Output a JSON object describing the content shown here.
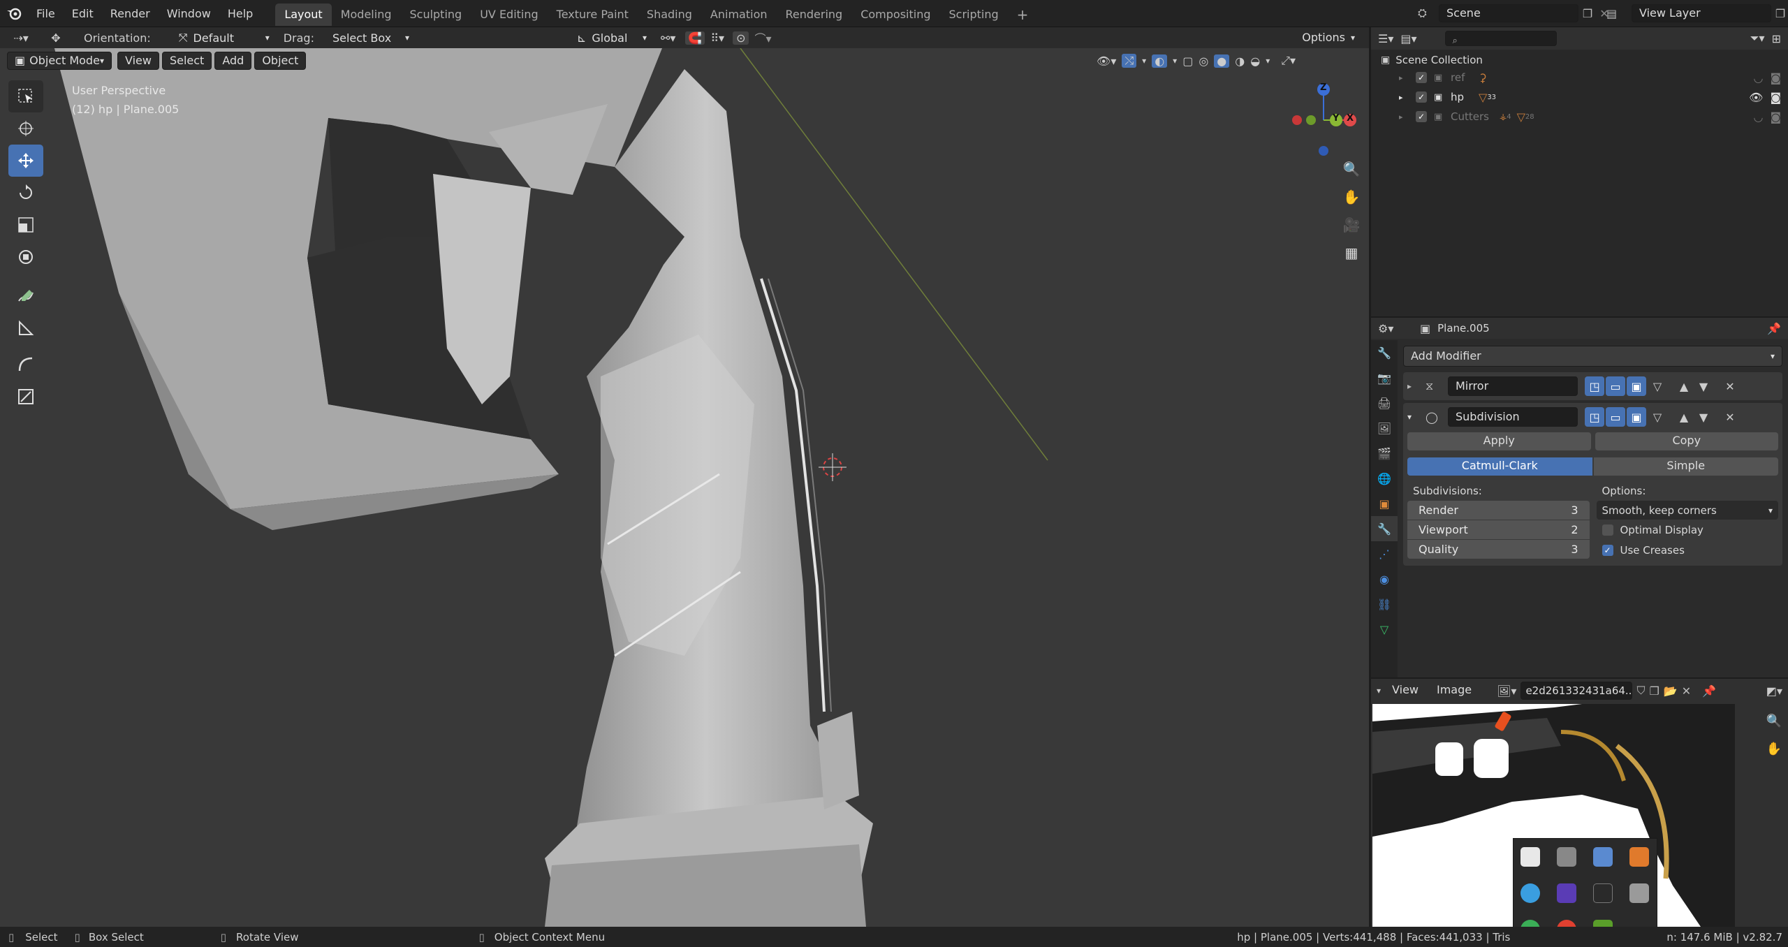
{
  "topbar": {
    "menus": [
      "File",
      "Edit",
      "Render",
      "Window",
      "Help"
    ],
    "workspaces": [
      "Layout",
      "Modeling",
      "Sculpting",
      "UV Editing",
      "Texture Paint",
      "Shading",
      "Animation",
      "Rendering",
      "Compositing",
      "Scripting"
    ],
    "active_workspace": "Layout",
    "add_tab": "+",
    "scene": "Scene",
    "view_layer": "View Layer"
  },
  "tool_header": {
    "orientation_label": "Orientation:",
    "orientation_value": "Default",
    "drag_label": "Drag:",
    "drag_value": "Select Box",
    "transform_orientation": "Global",
    "options": "Options"
  },
  "viewport_header": {
    "mode": "Object Mode",
    "menus": [
      "View",
      "Select",
      "Add",
      "Object"
    ]
  },
  "viewport": {
    "line1": "User Perspective",
    "line2": "(12) hp | Plane.005",
    "gizmo": {
      "z": "Z",
      "y": "Y",
      "x": "X"
    }
  },
  "outliner": {
    "title": "Scene Collection",
    "search_placeholder": "",
    "items": [
      {
        "name": "ref",
        "badge": ""
      },
      {
        "name": "hp",
        "badge": "33"
      },
      {
        "name": "Cutters",
        "badge1": "4",
        "badge2": "28"
      }
    ]
  },
  "properties": {
    "object_name": "Plane.005",
    "add_modifier": "Add Modifier",
    "modifiers": [
      {
        "name": "Mirror",
        "expanded": false
      },
      {
        "name": "Subdivision",
        "expanded": true
      }
    ],
    "apply": "Apply",
    "copy": "Copy",
    "types": [
      "Catmull-Clark",
      "Simple"
    ],
    "active_type": "Catmull-Clark",
    "subdivisions_label": "Subdivisions:",
    "options_label": "Options:",
    "render_label": "Render",
    "render_value": "3",
    "viewport_label": "Viewport",
    "viewport_value": "2",
    "quality_label": "Quality",
    "quality_value": "3",
    "uv_smooth": "Smooth, keep corners",
    "optimal_display": "Optimal Display",
    "optimal_display_checked": false,
    "use_creases": "Use Creases",
    "use_creases_checked": true
  },
  "image_editor": {
    "menus": [
      "View",
      "Image"
    ],
    "image_name": "e2d261332431a64..."
  },
  "status_bar": {
    "select": "Select",
    "box_select": "Box Select",
    "rotate_view": "Rotate View",
    "context_menu": "Object Context Menu",
    "stats_left": "hp | Plane.005 | Verts:441,488 | Faces:441,033 | Tris",
    "stats_right": "n: 147.6 MiB | v2.82.7"
  },
  "colors": {
    "accent": "#4772b3",
    "bg": "#393939",
    "panel": "#303030",
    "header": "#232323"
  }
}
